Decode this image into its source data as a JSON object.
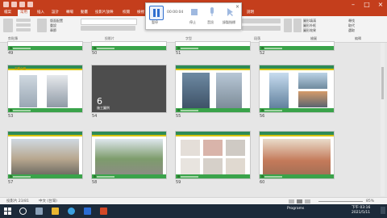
{
  "window": {
    "title": ""
  },
  "tabs": [
    "檔案",
    "常用",
    "插入",
    "設計",
    "轉場",
    "動畫",
    "投影片放映",
    "校閱",
    "檢視",
    "說明"
  ],
  "ribbon": {
    "groups": [
      "剪貼簿",
      "投影片",
      "字型",
      "段落",
      "繪圖",
      "編輯"
    ],
    "find": "尋找",
    "replace": "取代",
    "select": "選取",
    "slide_labels": [
      "版面配置",
      "重設",
      "章節"
    ],
    "shape_labels": [
      "圖形填滿",
      "圖形外框",
      "圖形效果"
    ]
  },
  "recorder": {
    "pause_label": "暫停",
    "timer": "00:00:04",
    "stop_label": "停止",
    "audio_label": "音訊",
    "pointer_label": "錄製指標"
  },
  "section_number": "6",
  "section_title": "施工圖例",
  "slide_header_title": "工程介紹",
  "slides_row0": [
    "49",
    "50",
    "51",
    "52"
  ],
  "slides_row1": [
    "53",
    "54",
    "55",
    "56"
  ],
  "slides_row2": [
    "57",
    "58",
    "59",
    "60"
  ],
  "status": {
    "slide_counter": "投影片 23/81",
    "language": "中文 (台灣)",
    "zoom": "85%"
  },
  "taskbar": {
    "time": "下午 03:16",
    "date": "2021/5/11",
    "tray_label": "Programs"
  },
  "colors": {
    "accent": "#c43e1c",
    "green": "#2e8b57",
    "yellow": "#d7c300"
  }
}
